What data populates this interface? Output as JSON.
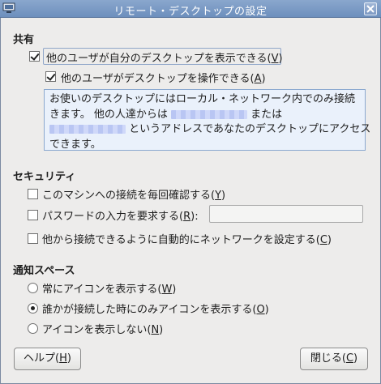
{
  "window": {
    "title": "リモート・デスクトップの設定",
    "app_icon": "remote-desktop-icon",
    "close_icon": "close-icon"
  },
  "sharing": {
    "title": "共有",
    "allow_view": {
      "text": "他のユーザが自分のデスクトップを表示できる(",
      "key": "V",
      "end": ")",
      "checked": true
    },
    "allow_control": {
      "text": "他のユーザがデスクトップを操作できる(",
      "key": "A",
      "end": ")",
      "checked": true
    },
    "info": {
      "line1": "お使いのデスクトップにはローカル・ネットワーク内でのみ接続",
      "line2_a": "きます。 他の人達からは",
      "line2_b": "または",
      "line3": "というアドレスであなたのデスクトップにアクセス",
      "line4": "できます。"
    }
  },
  "security": {
    "title": "セキュリティ",
    "confirm": {
      "text": "このマシンへの接続を毎回確認する(",
      "key": "Y",
      "end": ")",
      "checked": false
    },
    "password": {
      "text": "パスワードの入力を要求する(",
      "key": "R",
      "end": "):",
      "checked": false,
      "value": ""
    },
    "auto_network": {
      "text": "他から接続できるように自動的にネットワークを設定する(",
      "key": "C",
      "end": ")",
      "checked": false
    }
  },
  "notify": {
    "title": "通知スペース",
    "always": {
      "text": "常にアイコンを表示する(",
      "key": "W",
      "end": ")",
      "selected": false
    },
    "connected": {
      "text": "誰かが接続した時にのみアイコンを表示する(",
      "key": "O",
      "end": ")",
      "selected": true
    },
    "never": {
      "text": "アイコンを表示しない(",
      "key": "N",
      "end": ")",
      "selected": false
    }
  },
  "buttons": {
    "help": {
      "text": "ヘルプ(",
      "key": "H",
      "end": ")"
    },
    "close": {
      "text": "閉じる(",
      "key": "C",
      "end": ")"
    }
  }
}
